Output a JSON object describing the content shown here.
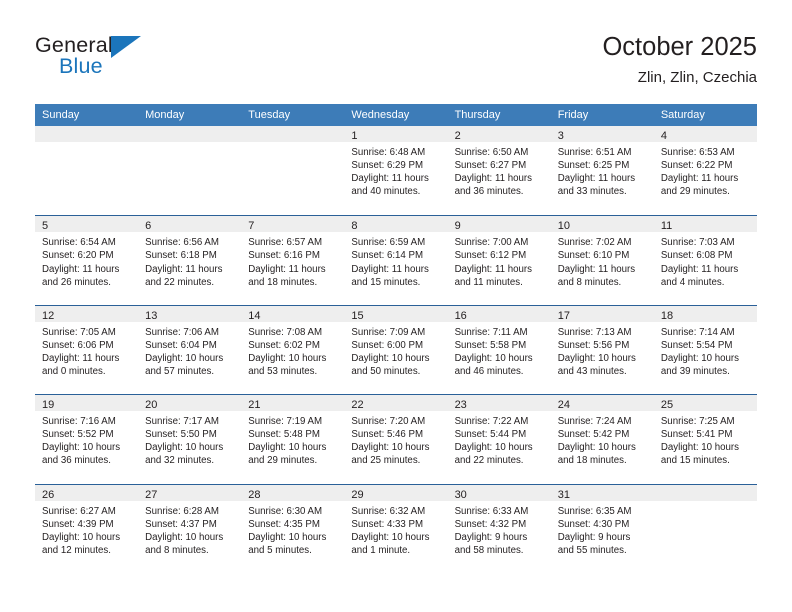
{
  "logo": {
    "word_one": "General",
    "word_two": "Blue",
    "triangle_icon": "blue-triangle-icon"
  },
  "header": {
    "title": "October 2025",
    "location": "Zlin, Zlin, Czechia"
  },
  "theme": {
    "header_blue": "#3d7cb8",
    "row_divider_blue": "#2a6098",
    "day_strip_gray": "#eeeeee",
    "logo_blue": "#1b75bb",
    "text_dark": "#231f20"
  },
  "weekdays": [
    "Sunday",
    "Monday",
    "Tuesday",
    "Wednesday",
    "Thursday",
    "Friday",
    "Saturday"
  ],
  "weeks": [
    [
      {
        "day": "",
        "lines": []
      },
      {
        "day": "",
        "lines": []
      },
      {
        "day": "",
        "lines": []
      },
      {
        "day": "1",
        "lines": [
          "Sunrise: 6:48 AM",
          "Sunset: 6:29 PM",
          "Daylight: 11 hours",
          "and 40 minutes."
        ]
      },
      {
        "day": "2",
        "lines": [
          "Sunrise: 6:50 AM",
          "Sunset: 6:27 PM",
          "Daylight: 11 hours",
          "and 36 minutes."
        ]
      },
      {
        "day": "3",
        "lines": [
          "Sunrise: 6:51 AM",
          "Sunset: 6:25 PM",
          "Daylight: 11 hours",
          "and 33 minutes."
        ]
      },
      {
        "day": "4",
        "lines": [
          "Sunrise: 6:53 AM",
          "Sunset: 6:22 PM",
          "Daylight: 11 hours",
          "and 29 minutes."
        ]
      }
    ],
    [
      {
        "day": "5",
        "lines": [
          "Sunrise: 6:54 AM",
          "Sunset: 6:20 PM",
          "Daylight: 11 hours",
          "and 26 minutes."
        ]
      },
      {
        "day": "6",
        "lines": [
          "Sunrise: 6:56 AM",
          "Sunset: 6:18 PM",
          "Daylight: 11 hours",
          "and 22 minutes."
        ]
      },
      {
        "day": "7",
        "lines": [
          "Sunrise: 6:57 AM",
          "Sunset: 6:16 PM",
          "Daylight: 11 hours",
          "and 18 minutes."
        ]
      },
      {
        "day": "8",
        "lines": [
          "Sunrise: 6:59 AM",
          "Sunset: 6:14 PM",
          "Daylight: 11 hours",
          "and 15 minutes."
        ]
      },
      {
        "day": "9",
        "lines": [
          "Sunrise: 7:00 AM",
          "Sunset: 6:12 PM",
          "Daylight: 11 hours",
          "and 11 minutes."
        ]
      },
      {
        "day": "10",
        "lines": [
          "Sunrise: 7:02 AM",
          "Sunset: 6:10 PM",
          "Daylight: 11 hours",
          "and 8 minutes."
        ]
      },
      {
        "day": "11",
        "lines": [
          "Sunrise: 7:03 AM",
          "Sunset: 6:08 PM",
          "Daylight: 11 hours",
          "and 4 minutes."
        ]
      }
    ],
    [
      {
        "day": "12",
        "lines": [
          "Sunrise: 7:05 AM",
          "Sunset: 6:06 PM",
          "Daylight: 11 hours",
          "and 0 minutes."
        ]
      },
      {
        "day": "13",
        "lines": [
          "Sunrise: 7:06 AM",
          "Sunset: 6:04 PM",
          "Daylight: 10 hours",
          "and 57 minutes."
        ]
      },
      {
        "day": "14",
        "lines": [
          "Sunrise: 7:08 AM",
          "Sunset: 6:02 PM",
          "Daylight: 10 hours",
          "and 53 minutes."
        ]
      },
      {
        "day": "15",
        "lines": [
          "Sunrise: 7:09 AM",
          "Sunset: 6:00 PM",
          "Daylight: 10 hours",
          "and 50 minutes."
        ]
      },
      {
        "day": "16",
        "lines": [
          "Sunrise: 7:11 AM",
          "Sunset: 5:58 PM",
          "Daylight: 10 hours",
          "and 46 minutes."
        ]
      },
      {
        "day": "17",
        "lines": [
          "Sunrise: 7:13 AM",
          "Sunset: 5:56 PM",
          "Daylight: 10 hours",
          "and 43 minutes."
        ]
      },
      {
        "day": "18",
        "lines": [
          "Sunrise: 7:14 AM",
          "Sunset: 5:54 PM",
          "Daylight: 10 hours",
          "and 39 minutes."
        ]
      }
    ],
    [
      {
        "day": "19",
        "lines": [
          "Sunrise: 7:16 AM",
          "Sunset: 5:52 PM",
          "Daylight: 10 hours",
          "and 36 minutes."
        ]
      },
      {
        "day": "20",
        "lines": [
          "Sunrise: 7:17 AM",
          "Sunset: 5:50 PM",
          "Daylight: 10 hours",
          "and 32 minutes."
        ]
      },
      {
        "day": "21",
        "lines": [
          "Sunrise: 7:19 AM",
          "Sunset: 5:48 PM",
          "Daylight: 10 hours",
          "and 29 minutes."
        ]
      },
      {
        "day": "22",
        "lines": [
          "Sunrise: 7:20 AM",
          "Sunset: 5:46 PM",
          "Daylight: 10 hours",
          "and 25 minutes."
        ]
      },
      {
        "day": "23",
        "lines": [
          "Sunrise: 7:22 AM",
          "Sunset: 5:44 PM",
          "Daylight: 10 hours",
          "and 22 minutes."
        ]
      },
      {
        "day": "24",
        "lines": [
          "Sunrise: 7:24 AM",
          "Sunset: 5:42 PM",
          "Daylight: 10 hours",
          "and 18 minutes."
        ]
      },
      {
        "day": "25",
        "lines": [
          "Sunrise: 7:25 AM",
          "Sunset: 5:41 PM",
          "Daylight: 10 hours",
          "and 15 minutes."
        ]
      }
    ],
    [
      {
        "day": "26",
        "lines": [
          "Sunrise: 6:27 AM",
          "Sunset: 4:39 PM",
          "Daylight: 10 hours",
          "and 12 minutes."
        ]
      },
      {
        "day": "27",
        "lines": [
          "Sunrise: 6:28 AM",
          "Sunset: 4:37 PM",
          "Daylight: 10 hours",
          "and 8 minutes."
        ]
      },
      {
        "day": "28",
        "lines": [
          "Sunrise: 6:30 AM",
          "Sunset: 4:35 PM",
          "Daylight: 10 hours",
          "and 5 minutes."
        ]
      },
      {
        "day": "29",
        "lines": [
          "Sunrise: 6:32 AM",
          "Sunset: 4:33 PM",
          "Daylight: 10 hours",
          "and 1 minute."
        ]
      },
      {
        "day": "30",
        "lines": [
          "Sunrise: 6:33 AM",
          "Sunset: 4:32 PM",
          "Daylight: 9 hours",
          "and 58 minutes."
        ]
      },
      {
        "day": "31",
        "lines": [
          "Sunrise: 6:35 AM",
          "Sunset: 4:30 PM",
          "Daylight: 9 hours",
          "and 55 minutes."
        ]
      },
      {
        "day": "",
        "lines": []
      }
    ]
  ]
}
